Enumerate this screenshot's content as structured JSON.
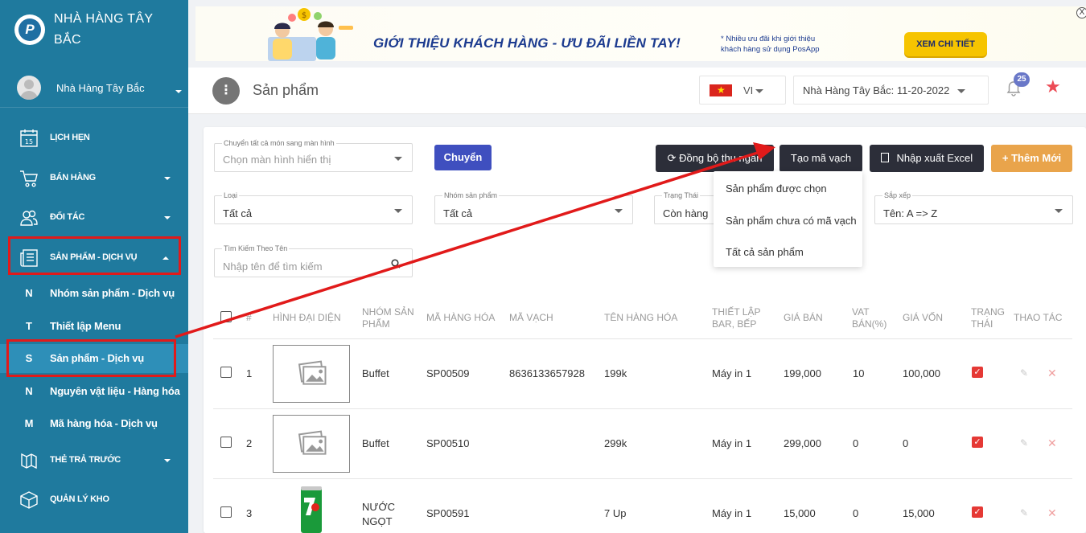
{
  "sidebar": {
    "brand": "NHÀ HÀNG TÂY BẮC",
    "user": "Nhà Hàng Tây Bắc",
    "menu": [
      {
        "label": "LỊCH HẸN",
        "icon": "calendar-icon",
        "badge": "15"
      },
      {
        "label": "BÁN HÀNG",
        "icon": "cart-icon"
      },
      {
        "label": "ĐỐI TÁC",
        "icon": "users-icon"
      },
      {
        "label": "SẢN PHẨM - DỊCH VỤ",
        "icon": "newspaper-icon"
      },
      {
        "label": "THẺ TRẢ TRƯỚC",
        "icon": "card-icon"
      },
      {
        "label": "QUẢN LÝ KHO",
        "icon": "box-icon"
      }
    ],
    "submenu": [
      {
        "key": "N",
        "label": "Nhóm sản phẩm - Dịch vụ"
      },
      {
        "key": "T",
        "label": "Thiết lập Menu"
      },
      {
        "key": "S",
        "label": "Sản phẩm - Dịch vụ"
      },
      {
        "key": "N",
        "label": "Nguyên vật liệu - Hàng hóa"
      },
      {
        "key": "M",
        "label": "Mã hàng hóa - Dịch vụ"
      }
    ]
  },
  "banner": {
    "title": "GIỚI THIỆU KHÁCH HÀNG - ƯU ĐÃI LIỀN TAY!",
    "note_line1": "* Nhiều ưu đãi khi giới thiệu",
    "note_line2": "khách hàng sử dụng PosApp",
    "button": "XEM CHI TIẾT",
    "close": "X"
  },
  "header": {
    "title": "Sản phẩm",
    "lang": "VI",
    "store": "Nhà Hàng Tây Bắc: 11-20-2022",
    "notifications": "25"
  },
  "filters": {
    "move_label": "Chuyển tất cả món sang màn hình",
    "move_placeholder": "Chọn màn hình hiển thị",
    "move_button": "Chuyển",
    "type_label": "Loại",
    "type_value": "Tất cả",
    "group_label": "Nhóm sản phẩm",
    "group_value": "Tất cả",
    "status_label": "Trạng Thái",
    "status_value": "Còn hàng",
    "sort_label": "Sắp xếp",
    "sort_value": "Tên: A => Z",
    "search_label": "Tìm Kiếm Theo Tên",
    "search_placeholder": "Nhập tên để tìm kiếm"
  },
  "toolbar": {
    "sync": "Đồng bộ thu ngân",
    "barcode": "Tạo mã vạch",
    "excel": "Nhập xuất Excel",
    "add": "+ Thêm Mới"
  },
  "barcode_menu": [
    "Sản phẩm được chọn",
    "Sản phẩm chưa có mã vạch",
    "Tất cả sản phẩm"
  ],
  "table": {
    "headers": {
      "num": "#",
      "image": "HÌNH ĐẠI DIỆN",
      "group_l1": "NHÓM SẢN",
      "group_l2": "PHẨM",
      "code": "MÃ HÀNG HÓA",
      "barcode": "MÃ VẠCH",
      "name": "TÊN HÀNG HÓA",
      "setup_l1": "THIẾT LẬP",
      "setup_l2": "BAR, BẾP",
      "price": "GIÁ BÁN",
      "vat_l1": "VAT",
      "vat_l2": "BÁN(%)",
      "cost": "GIÁ VỐN",
      "status_l1": "TRẠNG",
      "status_l2": "THÁI",
      "action": "THAO TÁC"
    },
    "rows": [
      {
        "num": "1",
        "group": "Buffet",
        "code": "SP00509",
        "barcode": "8636133657928",
        "name": "199k",
        "setup": "Máy in 1",
        "price": "199,000",
        "vat": "10",
        "cost": "100,000"
      },
      {
        "num": "2",
        "group": "Buffet",
        "code": "SP00510",
        "barcode": "",
        "name": "299k",
        "setup": "Máy in 1",
        "price": "299,000",
        "vat": "0",
        "cost": "0"
      },
      {
        "num": "3",
        "group_l1": "NƯỚC",
        "group_l2": "NGỌT",
        "code": "SP00591",
        "barcode": "",
        "name": "7 Up",
        "setup": "Máy in 1",
        "price": "15,000",
        "vat": "0",
        "cost": "15,000"
      }
    ]
  },
  "colors": {
    "sidebar": "#1f7a9e",
    "accent_red": "#e11a1a",
    "primary_button": "#3f4fbf",
    "add_button": "#e9a44b"
  }
}
